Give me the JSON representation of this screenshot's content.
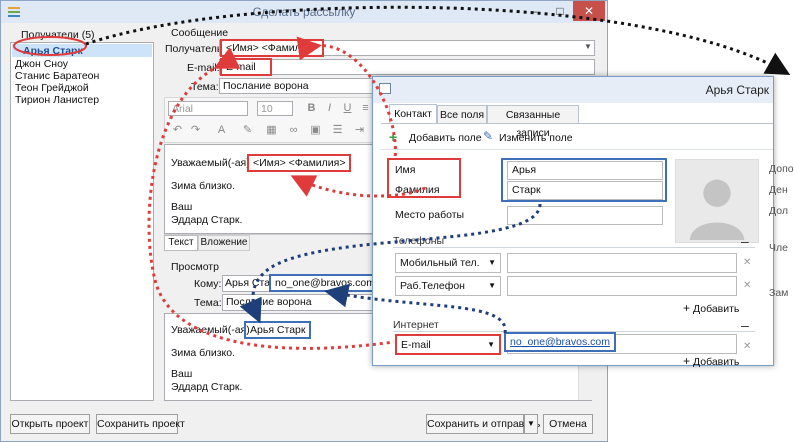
{
  "main_window": {
    "title": "Сделать рассылку",
    "recipients_header": "Получатели (5)",
    "recipients": [
      "Арья Старк",
      "Джон Сноу",
      "Станис Баратеон",
      "Теон Грейджой",
      "Тирион Ланистер"
    ],
    "message_section": "Сообщение",
    "recipient_label": "Получатель:",
    "recipient_value": "<Имя> <Фамилия>",
    "email_label": "E-mail:",
    "email_value": "E-mail",
    "subject_label": "Тема:",
    "subject_value": "Послание ворона",
    "font_name": "Arial",
    "font_size": "10",
    "editor_lines": {
      "greeting": "Уважаемый(-ая)",
      "greeting_placeholder": "<Имя> <Фамилия>",
      "line2": "Зима близко.",
      "line3": "Ваш",
      "line4": "Эддард Старк."
    },
    "editor_tabs": [
      "Текст",
      "Вложение"
    ],
    "preview_section": "Просмотр",
    "to_label": "Кому:",
    "to_name": "Арья Старк",
    "to_email": "no_one@bravos.com",
    "preview_subject_label": "Тема:",
    "preview_subject": "Послание ворона",
    "preview_lines": {
      "greeting": "Уважаемый(-ая)",
      "name": "Арья Старк",
      "line2": "Зима близко.",
      "line3": "Ваш",
      "line4": "Эддард Старк."
    },
    "buttons": {
      "open": "Открыть проект",
      "save": "Сохранить проект",
      "save_send": "Сохранить и отправить",
      "cancel": "Отмена"
    }
  },
  "contact_window": {
    "title": "Арья Старк",
    "tabs": [
      "Контакт",
      "Все поля",
      "Связанные записи"
    ],
    "toolbar": {
      "add_field": "Добавить поле",
      "edit_field": "Изменить поле"
    },
    "first_name_label": "Имя",
    "first_name_value": "Арья",
    "last_name_label": "Фамилия",
    "last_name_value": "Старк",
    "work_label": "Место работы",
    "phones_section": "Телефоны",
    "phone_type_1": "Мобильный тел.",
    "phone_type_2": "Раб.Телефон",
    "add_label": "Добавить",
    "internet_section": "Интернет",
    "email_type": "E-mail",
    "email_value": "no_one@bravos.com",
    "right_col": [
      "Допо",
      "Ден",
      "Дол",
      "Чле",
      "Зам"
    ]
  },
  "colors": {
    "highlight_red": "#e03b3b",
    "highlight_blue": "#3f6fb7",
    "arrow_black": "#111111"
  }
}
